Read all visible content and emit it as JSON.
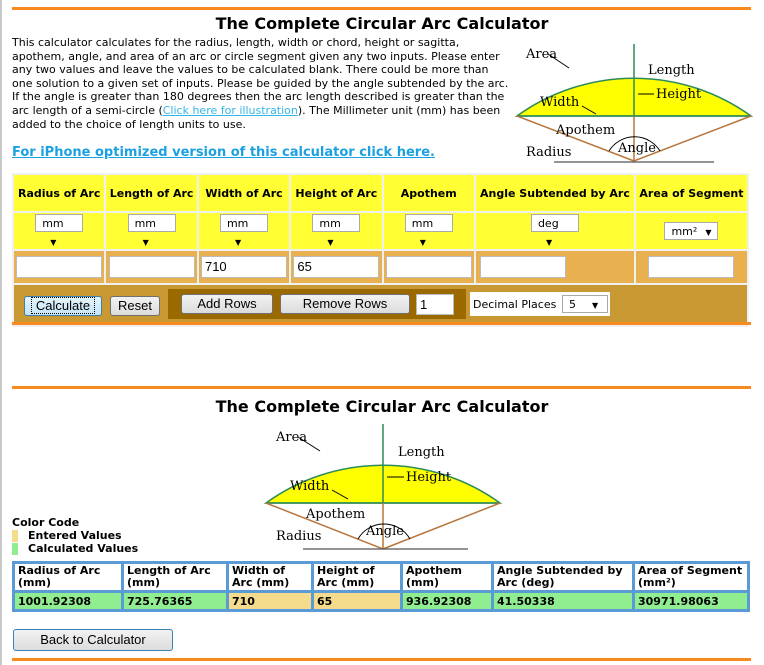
{
  "calculator": {
    "title": "The Complete Circular Arc Calculator",
    "description": "This calculator calculates for the radius, length, width or chord, height or sagitta, apothem, angle, and area of an arc or circle segment given any two inputs. Please enter any two values and leave the values to be calculated blank. There could be more than one solution to a given set of inputs. Please be guided by the angle subtended by the arc. If the angle is greater than 180 degrees then the arc length described is greater than the arc length of a semi-circle (",
    "illustration_link": "Click here for illustration",
    "description_tail": "). The Millimeter unit (mm) has been added to the choice of length units to use.",
    "iphone_link": "For iPhone optimized version of this calculator click here.",
    "diagram_labels": {
      "area": "Area",
      "length": "Length",
      "height": "Height",
      "width": "Width",
      "apothem": "Apothem",
      "radius": "Radius",
      "angle": "Angle"
    },
    "columns": [
      {
        "header": "Radius of Arc",
        "unit": "mm",
        "value": ""
      },
      {
        "header": "Length of Arc",
        "unit": "mm",
        "value": ""
      },
      {
        "header": "Width of Arc",
        "unit": "mm",
        "value": "710"
      },
      {
        "header": "Height of Arc",
        "unit": "mm",
        "value": "65"
      },
      {
        "header": "Apothem",
        "unit": "mm",
        "value": ""
      },
      {
        "header": "Angle Subtended by Arc",
        "unit": "deg",
        "value": ""
      },
      {
        "header": "Area of Segment",
        "unit": "mm²",
        "value": ""
      }
    ],
    "buttons": {
      "calculate": "Calculate",
      "reset": "Reset",
      "add_rows": "Add Rows",
      "remove_rows": "Remove Rows",
      "rows_count": "1",
      "decimal_places_label": "Decimal Places",
      "decimal_places_value": "5"
    }
  },
  "results": {
    "title": "The Complete Circular Arc Calculator",
    "color_code": {
      "title": "Color Code",
      "entered": "Entered Values",
      "calculated": "Calculated Values",
      "entered_color": "#f5dc8c",
      "calculated_color": "#90ee90"
    },
    "columns": [
      {
        "header": "Radius of Arc (mm)",
        "value": "1001.92308",
        "type": "calculated"
      },
      {
        "header": "Length of Arc (mm)",
        "value": "725.76365",
        "type": "calculated"
      },
      {
        "header": "Width of Arc (mm)",
        "value": "710",
        "type": "entered"
      },
      {
        "header": "Height of Arc (mm)",
        "value": "65",
        "type": "entered"
      },
      {
        "header": "Apothem (mm)",
        "value": "936.92308",
        "type": "calculated"
      },
      {
        "header": "Angle Subtended by Arc (deg)",
        "value": "41.50338",
        "type": "calculated"
      },
      {
        "header": "Area of Segment (mm²)",
        "value": "30971.98063",
        "type": "calculated"
      }
    ],
    "back_button": "Back to Calculator"
  }
}
